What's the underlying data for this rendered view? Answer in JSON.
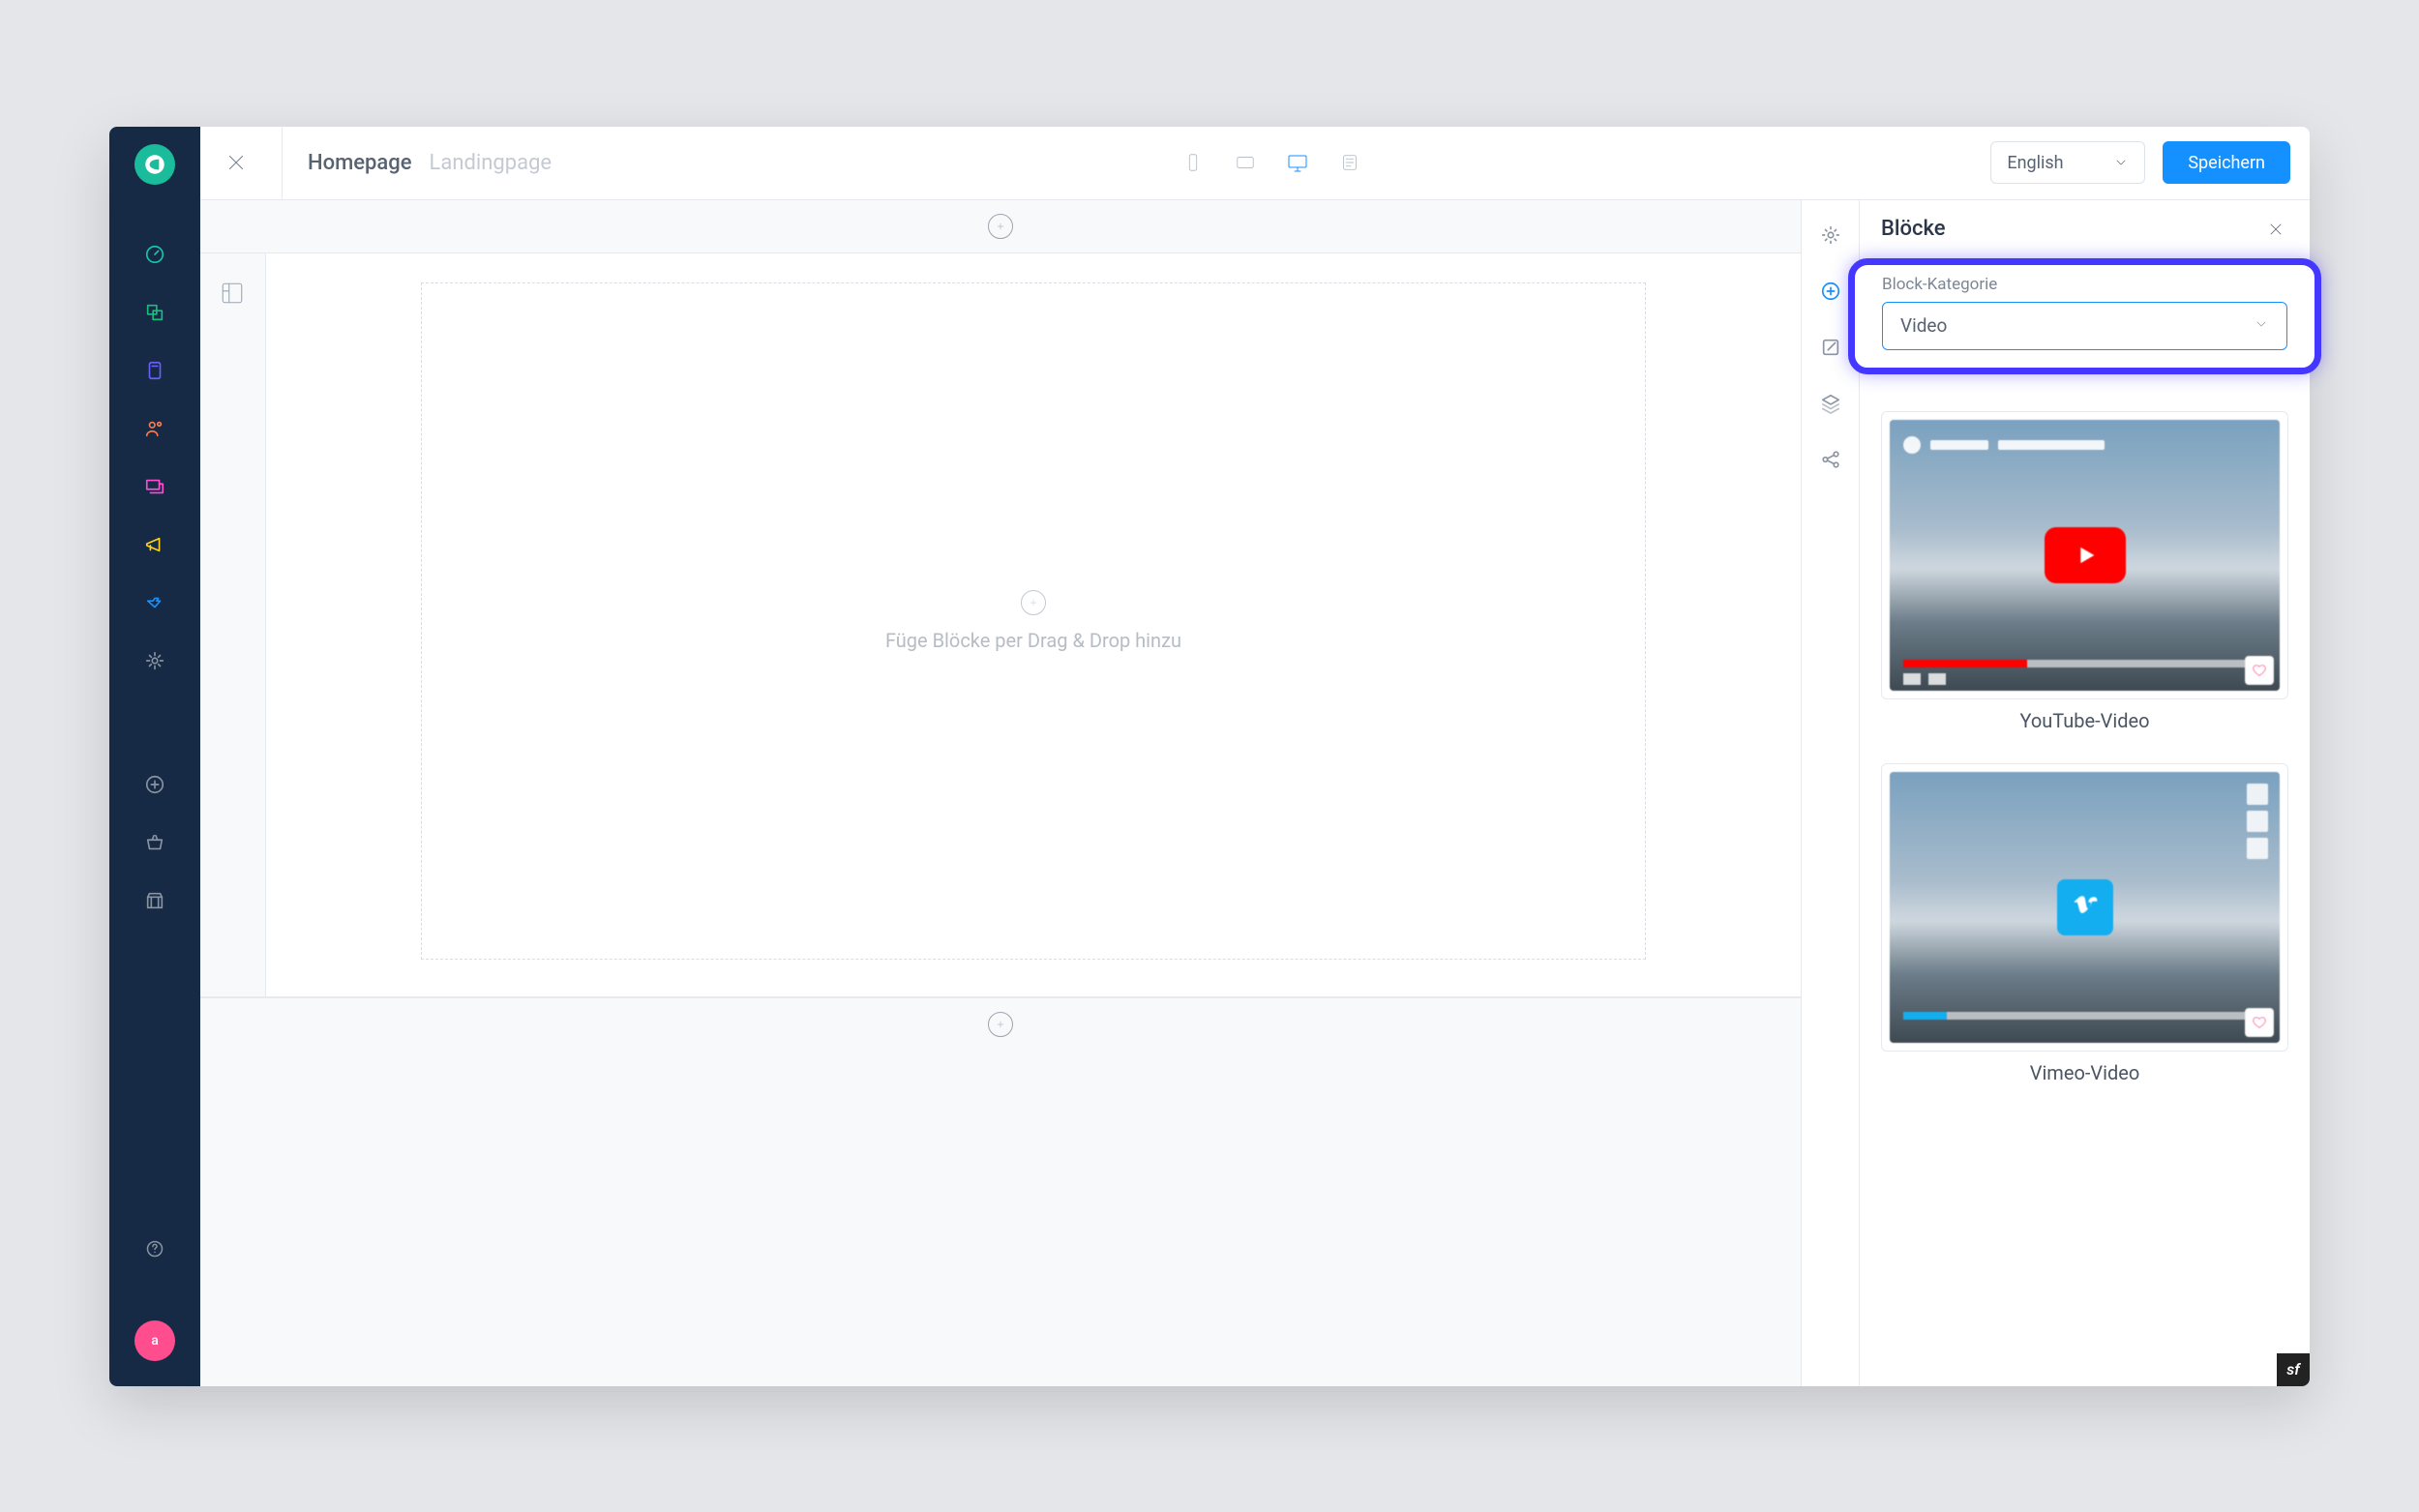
{
  "header": {
    "breadcrumb_current": "Homepage",
    "breadcrumb_secondary": "Landingpage",
    "language": "English",
    "save_label": "Speichern"
  },
  "canvas": {
    "drop_hint": "Füge Blöcke per Drag & Drop hinzu"
  },
  "panel": {
    "title": "Blöcke",
    "category_label": "Block-Kategorie",
    "category_value": "Video",
    "blocks": {
      "youtube": "YouTube-Video",
      "vimeo": "Vimeo-Video"
    }
  },
  "avatar_initial": "a"
}
